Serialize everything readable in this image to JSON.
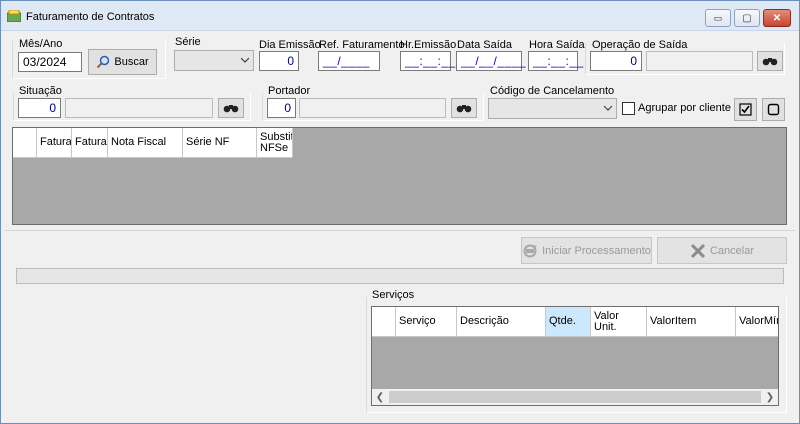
{
  "window": {
    "title": "Faturamento de Contratos",
    "controls": {
      "minimize": "▭",
      "maximize": "▢",
      "close": "✕"
    }
  },
  "filters": {
    "mes_ano_label": "Mês/Ano",
    "mes_ano_value": "03/2024",
    "buscar_label": "Buscar",
    "serie_label": "Série",
    "dia_emissao_label": "Dia Emissão",
    "dia_emissao_value": "0",
    "ref_faturamento_label": "Ref. Faturamento",
    "ref_faturamento_value": "__/____",
    "hr_emissao_label": "Hr.Emissão",
    "hr_emissao_value": "__:__:__",
    "data_saida_label": "Data Saída",
    "data_saida_value": "__/__/____",
    "hora_saida_label": "Hora Saída",
    "hora_saida_value": "__:__:__",
    "operacao_saida_label": "Operação de Saída",
    "operacao_saida_value": "0",
    "situacao_label": "Situação",
    "situacao_value": "0",
    "portador_label": "Portador",
    "portador_value": "0",
    "codigo_cancelamento_label": "Código de Cancelamento",
    "agrupar_label": "Agrupar por cliente"
  },
  "contracts_grid": {
    "columns": [
      "Fatura",
      "Fatura",
      "Nota Fiscal",
      "Série NF",
      "Substit NFSe"
    ]
  },
  "actions": {
    "iniciar_label": "Iniciar Processamento",
    "cancelar_label": "Cancelar"
  },
  "servicos": {
    "group_label": "Serviços",
    "columns": [
      "Serviço",
      "Descrição",
      "Qtde.",
      "Valor Unit.",
      "ValorItem",
      "ValorMín"
    ]
  },
  "colors": {
    "accent": "#0078d7",
    "grid_bg": "#a8a8a8",
    "masked_text": "#0000c8"
  }
}
